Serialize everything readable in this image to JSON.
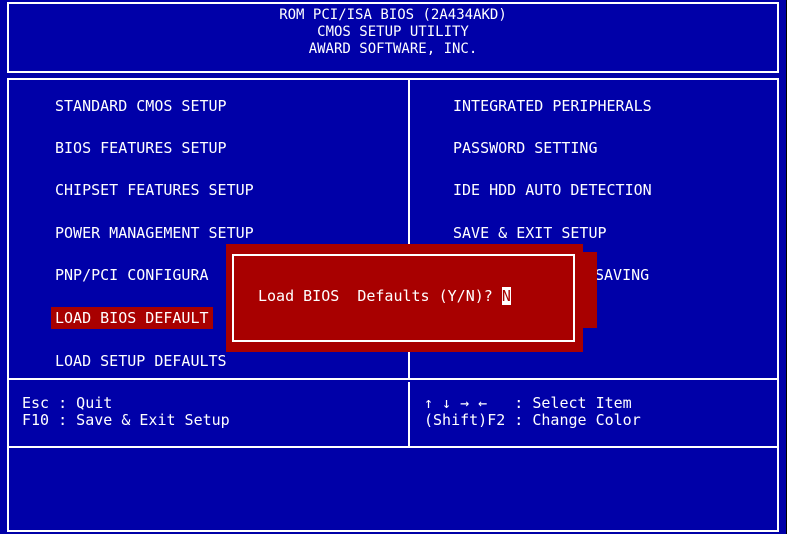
{
  "header": {
    "line1": "ROM PCI/ISA BIOS (2A434AKD)",
    "line2": "CMOS SETUP UTILITY",
    "line3": "AWARD SOFTWARE, INC."
  },
  "menu": {
    "left": [
      "STANDARD CMOS SETUP",
      "BIOS FEATURES SETUP",
      "CHIPSET FEATURES SETUP",
      "POWER MANAGEMENT SETUP",
      "PNP/PCI CONFIGURA",
      "LOAD BIOS DEFAULT",
      "LOAD SETUP DEFAULTS"
    ],
    "right": [
      "INTEGRATED PERIPHERALS",
      "PASSWORD SETTING",
      "IDE HDD AUTO DETECTION",
      "SAVE & EXIT SETUP",
      "SAVING"
    ]
  },
  "help": {
    "left1": "Esc : Quit",
    "left2": "F10 : Save & Exit Setup",
    "right1": "↑ ↓ → ←   : Select Item",
    "right2": "(Shift)F2 : Change Color"
  },
  "dialog": {
    "prompt": "Load BIOS  Defaults (Y/N)? ",
    "value": "N"
  },
  "colors": {
    "background": "#0000a8",
    "highlight": "#a80000",
    "text": "#ffffff"
  }
}
